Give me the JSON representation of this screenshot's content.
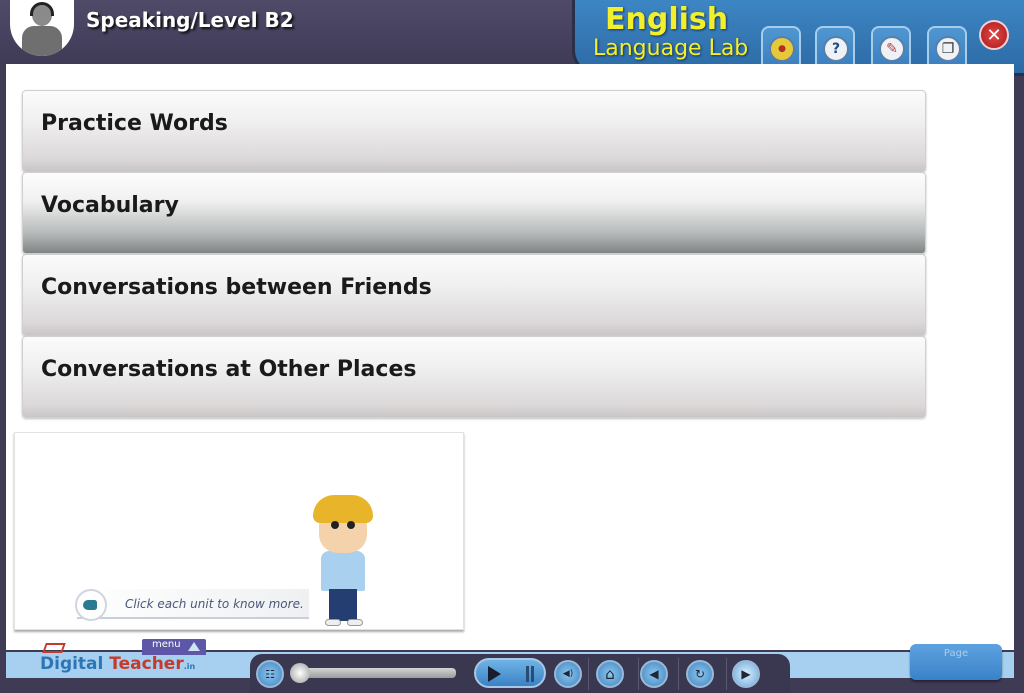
{
  "header": {
    "title": "Speaking/Level B2",
    "brand": {
      "line1": "English",
      "line2": "Language Lab"
    },
    "tools": [
      {
        "name": "resources-icon",
        "glyph": "●"
      },
      {
        "name": "help-icon",
        "glyph": "?"
      },
      {
        "name": "book-icon",
        "glyph": "✎"
      },
      {
        "name": "window-icon",
        "glyph": "❐"
      }
    ],
    "close_glyph": "✕"
  },
  "menu": {
    "items": [
      {
        "label": "Practice Words",
        "active": false
      },
      {
        "label": "Vocabulary",
        "active": true
      },
      {
        "label": "Conversations between Friends",
        "active": false
      },
      {
        "label": "Conversations at Other Places",
        "active": false
      }
    ]
  },
  "intro": {
    "hint": "Click each unit to know more."
  },
  "footer": {
    "logo_digital": "Digital ",
    "logo_teacher": "Teacher",
    "logo_suffix": ".in",
    "menu_label": "menu",
    "page_label": "Page",
    "controls": {
      "volume_glyph": "◀)",
      "home_glyph": "⌂",
      "back_glyph": "◀",
      "replay_glyph": "↻",
      "next_glyph": "▶"
    }
  },
  "colors": {
    "frame": "#3f3b55",
    "brand_blue": "#3d86c4",
    "brand_yellow": "#f2f02a",
    "close_red": "#c72a2a"
  }
}
